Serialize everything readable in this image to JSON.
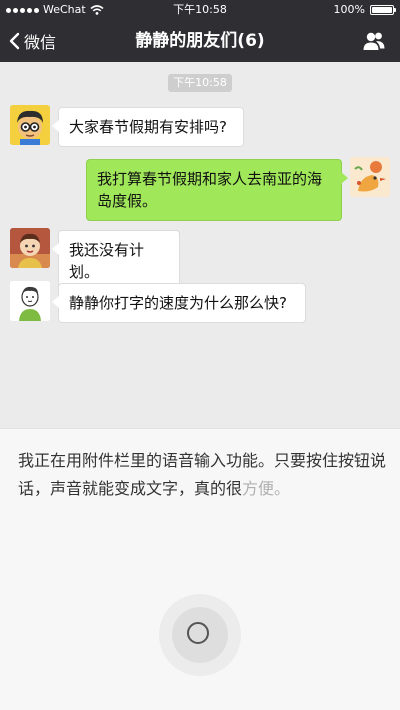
{
  "status_bar": {
    "carrier": "WeChat",
    "time": "下午10:58",
    "battery": "100%"
  },
  "nav": {
    "back_label": "微信",
    "title": "静静的朋友们(6)"
  },
  "chat": {
    "timestamp": "下午10:58",
    "messages": [
      {
        "side": "left",
        "text": "大家春节假期有安排吗?"
      },
      {
        "side": "right",
        "text": "我打算春节假期和家人去南亚的海岛度假。"
      },
      {
        "side": "left",
        "text": "我还没有计划。"
      },
      {
        "side": "left",
        "text": "静静你打字的速度为什么那么快?"
      }
    ]
  },
  "voice_input": {
    "text_main": "我正在用附件栏里的语音输入功能。只要按住按钮说话，声音就能变成文字，真的很",
    "text_faded": "方便。"
  },
  "colors": {
    "topbar": "#2f2f33",
    "chat_bg": "#ebebeb",
    "bubble_right": "#a0e75a",
    "bubble_left": "#ffffff"
  }
}
